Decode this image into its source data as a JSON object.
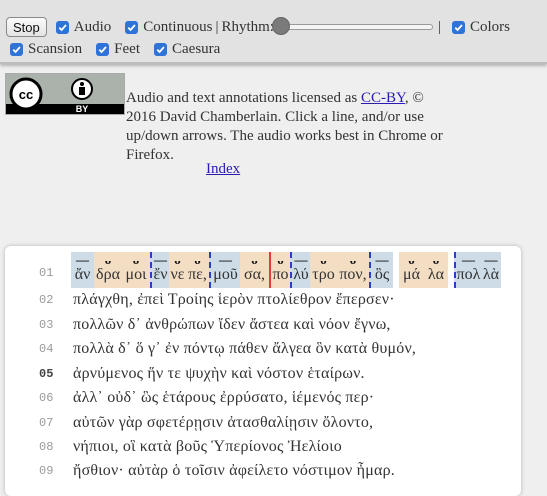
{
  "toolbar": {
    "stop_label": "Stop",
    "audio_label": "Audio",
    "continuous_label": "Continuous",
    "separator": "|",
    "rhythm_label": "Rhythm:",
    "rhythm_separator": "|",
    "colors_label": "Colors",
    "scansion_label": "Scansion",
    "feet_label": "Feet",
    "caesura_label": "Caesura",
    "rhythm_value": 0
  },
  "license": {
    "badge_cc": "cc",
    "badge_by": "BY",
    "text_before": "Audio and text annotations licensed as ",
    "link": "CC-BY",
    "text_after": ", © 2016 David Chamberlain. Click a line, and/or use up/down arrows. The audio works best in Chrome or Firefox."
  },
  "index_link": "Index",
  "lines": [
    {
      "num": "01",
      "syllables": [
        "ἄν",
        "δρα",
        "μοι",
        "ἔν",
        "νε",
        "πε,",
        "μοῦ",
        "σα,",
        "πο",
        "λύ",
        "τρο",
        "πον,",
        "ὃς",
        "μά",
        "λα",
        "πολ",
        "λὰ"
      ]
    },
    {
      "num": "02",
      "text": "πλάγχθη, ἐπεὶ Τροίης ἱερὸν πτολίεθρον ἔπερσεν·"
    },
    {
      "num": "03",
      "text": "πολλῶν δ᾽ ἀνθρώπων ἴδεν ἄστεα καὶ νόον ἔγνω,"
    },
    {
      "num": "04",
      "text": "πολλὰ δ᾽ ὅ γ᾽ ἐν πόντῳ πάθεν ἄλγεα ὃν κατὰ θυμόν,"
    },
    {
      "num": "05",
      "text": "ἀρνύμενος ἥν τε ψυχὴν καὶ νόστον ἑταίρων."
    },
    {
      "num": "06",
      "text": "ἀλλ᾽ οὐδ᾽ ὣς ἑτάρους ἐρρύσατο, ἱέμενός περ·"
    },
    {
      "num": "07",
      "text": "αὐτῶν γὰρ σφετέρῃσιν ἀτασθαλίῃσιν ὄλοντο,"
    },
    {
      "num": "08",
      "text": "νήπιοι, οἳ κατὰ βοῦς Ὑπερίονος Ἠελίοιο"
    },
    {
      "num": "09",
      "text": "ἤσθιον· αὐτὰρ ὁ τοῖσιν ἀφείλετο νόστιμον ἦμαρ."
    }
  ],
  "colors": {
    "long": "#cddce6",
    "short": "#f3ddc3",
    "caesura": "#e23b3b",
    "foot": "#2a3fc9",
    "link": "#2a1cb0"
  }
}
